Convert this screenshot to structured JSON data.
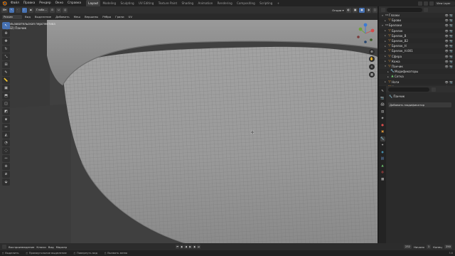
{
  "menubar": {
    "items": [
      "Файл",
      "Правка",
      "Рендер",
      "Окно",
      "Справка"
    ],
    "workspaces": [
      "Layout",
      "Modeling",
      "Sculpting",
      "UV Editing",
      "Texture Paint",
      "Shading",
      "Animation",
      "Rendering",
      "Compositing",
      "Scripting"
    ],
    "active_workspace": "Layout",
    "plus": "+",
    "view_layer": "View Layer"
  },
  "viewport_header": {
    "transform_orientation": "Глоба...",
    "snap_icon": "magnet-icon",
    "options": "Опции ▾"
  },
  "viewport_header2": {
    "mode": "Режим редак...",
    "menus": [
      "Вид",
      "Выделение",
      "Добавить",
      "Меш",
      "Вершины",
      "Рёбра",
      "Грани",
      "UV"
    ]
  },
  "viewport": {
    "perspective": "Пользовательская перспектива",
    "object_info": "(232) Панчик",
    "accent": "#4772b3",
    "background": "#3e3e3e"
  },
  "outliner": {
    "rows": [
      {
        "tri": "▾",
        "icon": "folder-icon",
        "name": "Глазки",
        "flags": "👁 📷"
      },
      {
        "tri": "▸",
        "icon": "mesh-icon",
        "name": "Брови",
        "flags": "👁 📷"
      },
      {
        "tri": "▾",
        "icon": "folder-icon",
        "name": "Брелоки",
        "flags": "👁 📷"
      },
      {
        "tri": "▸",
        "icon": "mesh-icon",
        "name": "Брелок",
        "flags": "👁 📷"
      },
      {
        "tri": "▸",
        "icon": "mesh-icon",
        "name": "Брелок_В",
        "flags": "👁 📷"
      },
      {
        "tri": "▸",
        "icon": "mesh-icon",
        "name": "Брелок_В2",
        "flags": "👁 📷"
      },
      {
        "tri": "▸",
        "icon": "mesh-icon",
        "name": "Брелок_Н",
        "flags": "👁 📷"
      },
      {
        "tri": "▸",
        "icon": "mesh-icon",
        "name": "Брелок_Н.001",
        "flags": "👁 📷"
      },
      {
        "tri": "▸",
        "icon": "mesh-icon",
        "name": "Сфера",
        "flags": "👁 📷"
      },
      {
        "tri": "▸",
        "icon": "mesh-icon",
        "name": "Кожа",
        "flags": "👁 📷"
      },
      {
        "tri": "▾",
        "icon": "mesh-icon",
        "name": "Панчик",
        "flags": "👁 📷"
      },
      {
        "tri": "▸",
        "icon": "wrench-icon",
        "name": "Модификаторы",
        "flags": ""
      },
      {
        "tri": "▸",
        "icon": "mesh-data-icon",
        "name": "Сетка",
        "flags": ""
      },
      {
        "tri": "▸",
        "icon": "mesh-icon",
        "name": "Ноги",
        "flags": "👁 📷"
      },
      {
        "tri": "▸",
        "icon": "mesh-icon",
        "name": "Усики",
        "flags": "👁 📷"
      }
    ]
  },
  "properties": {
    "object_name": "Панчик",
    "add_modifier": "Добавить модификатор",
    "tabs": [
      "tool-icon",
      "render-icon",
      "output-icon",
      "view-layer-icon",
      "scene-icon",
      "world-icon",
      "object-icon",
      "modifier-icon",
      "particles-icon",
      "physics-icon",
      "constraints-icon",
      "data-icon",
      "material-icon",
      "texture-icon"
    ]
  },
  "timeline": {
    "menus": [
      "Воспроизведение",
      "Ключи",
      "Вид",
      "Маркер"
    ],
    "current_frame": "232",
    "start_label": "Начало",
    "start": "1",
    "end_label": "Конец",
    "end": "250"
  },
  "statusbar": {
    "items": [
      "Выделить",
      "Прямоугольное выделение",
      "Повернуть вид",
      "Вызвать меню"
    ],
    "version": "3.6"
  }
}
